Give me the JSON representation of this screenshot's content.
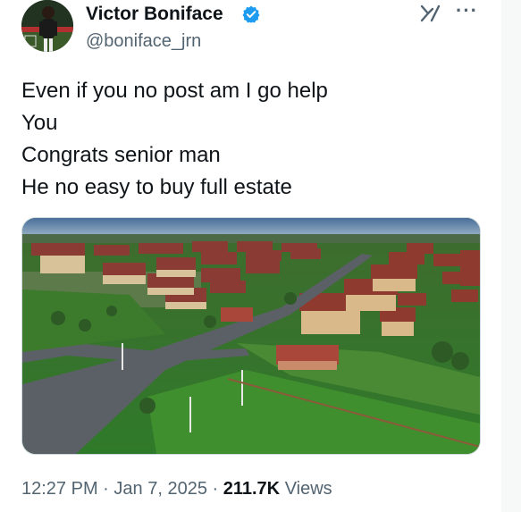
{
  "user": {
    "display_name": "Victor Boniface",
    "handle": "@boniface_jrn",
    "verified": true
  },
  "tweet": {
    "lines": [
      "Even if you no post am I go help",
      "You",
      "Congrats senior man",
      "He no easy to buy full estate"
    ]
  },
  "meta": {
    "time": "12:27 PM",
    "sep1": "·",
    "date": "Jan 7, 2025",
    "sep2": "·",
    "views_count": "211.7K",
    "views_label": "Views"
  },
  "icons": {
    "verified": "verified-badge-icon",
    "grok": "grok-icon",
    "more": "more-icon"
  },
  "colors": {
    "verified": "#1d9bf0",
    "secondary_text": "#536471",
    "primary_text": "#0f1419"
  }
}
